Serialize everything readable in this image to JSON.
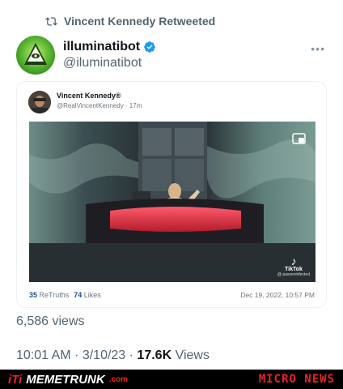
{
  "retweet": {
    "label": "Vincent Kennedy Retweeted"
  },
  "author": {
    "name": "illuminatibot",
    "handle": "@iluminatibot",
    "verified": true
  },
  "menu": {
    "icon": "more-horizontal-icon"
  },
  "embed": {
    "author_name": "Vincent Kennedy®",
    "author_handle_time": "@RealVincentKennedy · 17m",
    "video_watermark": "TikTok",
    "video_watermark_user": "@ passeninfected",
    "retruths_count": "35",
    "retruths_label": "ReTruths",
    "likes_count": "74",
    "likes_label": "Likes",
    "date": "Dec 19, 2022, 10:57 PM"
  },
  "tweet_views": "6,586 views",
  "meta": {
    "time_date": "10:01 AM · 3/10/23 · ",
    "views_count": "17.6K",
    "views_label": "Views"
  },
  "footer": {
    "logo": "iTi",
    "brand": "MEMETRUNK",
    "domain": ".com",
    "right_label": "MICRO NEWS"
  },
  "colors": {
    "accent_blue": "#1d9bf0",
    "muted": "#536471",
    "footer_red": "#e8232a"
  }
}
